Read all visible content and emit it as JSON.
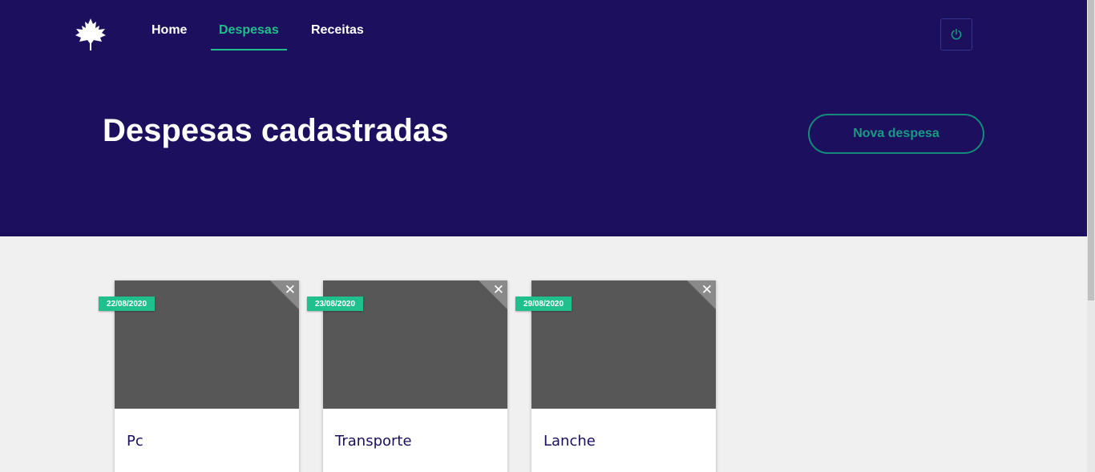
{
  "nav": {
    "items": [
      {
        "label": "Home",
        "active": false
      },
      {
        "label": "Despesas",
        "active": true
      },
      {
        "label": "Receitas",
        "active": false
      }
    ]
  },
  "header": {
    "title": "Despesas cadastradas",
    "new_button_label": "Nova despesa"
  },
  "icons": {
    "logo": "maple-leaf-icon",
    "logout": "power-icon",
    "delete": "close-icon"
  },
  "cards": [
    {
      "date": "22/08/2020",
      "title": "Pc"
    },
    {
      "date": "23/08/2020",
      "title": "Transporte"
    },
    {
      "date": "29/08/2020",
      "title": "Lanche"
    }
  ],
  "colors": {
    "header_bg": "#1c0f5e",
    "accent": "#1fc08c",
    "page_bg": "#f0f0f0",
    "card_media": "#575757"
  }
}
